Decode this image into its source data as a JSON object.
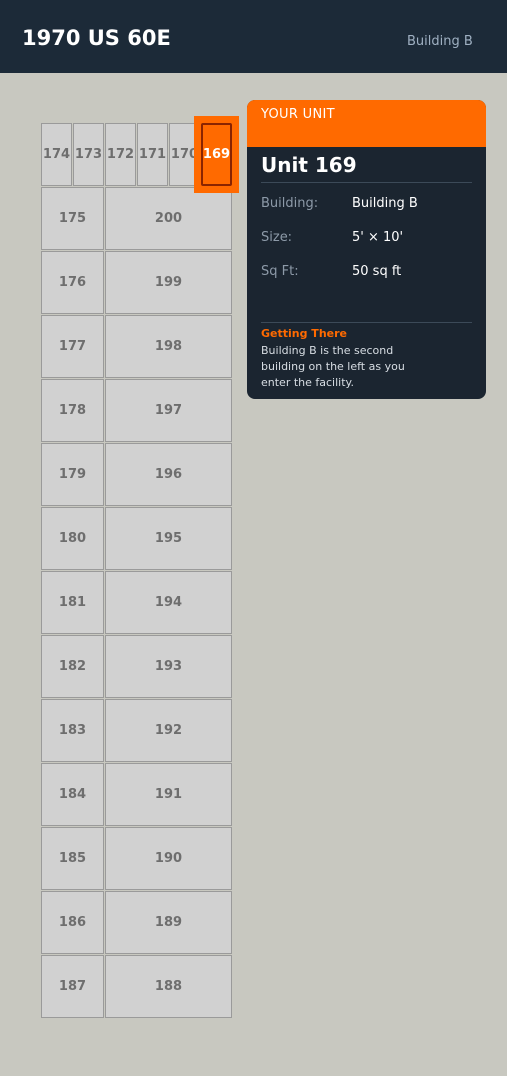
{
  "header": {
    "title": "1970 US 60E",
    "building": "Building B"
  },
  "units": {
    "top_row": [
      "174",
      "173",
      "172",
      "171",
      "170"
    ],
    "highlighted": "169",
    "left_column": [
      "175",
      "176",
      "177",
      "178",
      "179",
      "180",
      "181",
      "182",
      "183",
      "184",
      "185",
      "186",
      "187"
    ],
    "right_column": [
      "200",
      "199",
      "198",
      "197",
      "196",
      "195",
      "194",
      "193",
      "192",
      "191",
      "190",
      "189",
      "188"
    ]
  },
  "card": {
    "eyebrow": "YOUR UNIT",
    "title": "Unit 169",
    "rows": [
      {
        "label": "Building:",
        "value": "Building B"
      },
      {
        "label": "Size:",
        "value": "5' × 10'"
      },
      {
        "label": "Sq Ft:",
        "value": "50 sq ft"
      }
    ],
    "directions_title": "Getting There",
    "directions_text": "Building B is the second building on the left as you enter the facility."
  },
  "colors": {
    "header_bg": "#1c2a38",
    "accent": "#ff6a00",
    "card_bg": "#1b2530",
    "unit_bg": "#d1d1d1",
    "page_bg": "#c8c8c0"
  }
}
